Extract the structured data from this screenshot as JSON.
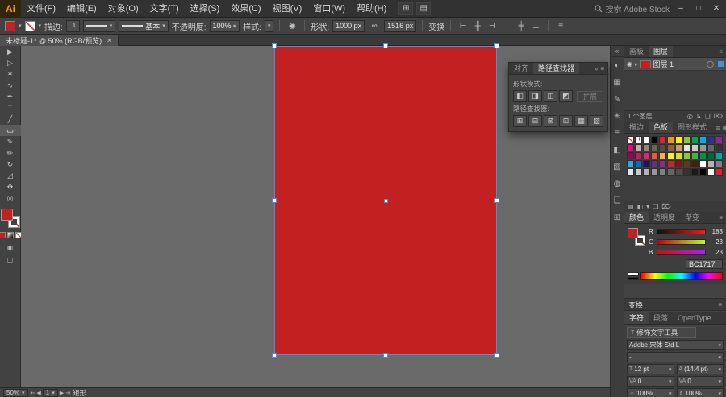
{
  "app": {
    "canvas_bg": "#6a6a6a"
  },
  "menubar": {
    "logo": "Ai",
    "items": [
      "文件(F)",
      "编辑(E)",
      "对象(O)",
      "文字(T)",
      "选择(S)",
      "效果(C)",
      "视图(V)",
      "窗口(W)",
      "帮助(H)"
    ],
    "app_icons": [
      {
        "name": "arrange-documents-icon",
        "glyph": "⊞"
      },
      {
        "name": "document-layout-icon",
        "glyph": "▤"
      }
    ],
    "search_label": "搜索 Adobe Stock",
    "window": {
      "minimize": "–",
      "restore": "□",
      "close": "✕"
    }
  },
  "controlbar": {
    "fill_color": "#C32021",
    "stroke_label": "描边:",
    "stroke_weight": "",
    "brush_value": "基本",
    "opacity_label": "不透明度:",
    "opacity_value": "100%",
    "style_label": "样式:",
    "recolor_glyph": "◉",
    "shape_label": "形状:",
    "width_value": "1000 px",
    "link_glyph": "∞",
    "height_value": "1516 px",
    "transform_label": "变换",
    "align_icons": [
      {
        "name": "align-left-icon",
        "glyph": "⊢"
      },
      {
        "name": "align-center-horizontal-icon",
        "glyph": "╫"
      },
      {
        "name": "align-right-icon",
        "glyph": "⊣"
      },
      {
        "name": "align-top-icon",
        "glyph": "⊤"
      },
      {
        "name": "align-middle-vertical-icon",
        "glyph": "╪"
      },
      {
        "name": "align-bottom-icon",
        "glyph": "⊥"
      }
    ],
    "menu_glyph": "≡"
  },
  "document_tab": {
    "title": "未标题-1* @ 50% (RGB/预览)",
    "close": "✕"
  },
  "tools": [
    {
      "name": "selection-tool",
      "glyph": "▶"
    },
    {
      "name": "direct-selection-tool",
      "glyph": "▷"
    },
    {
      "name": "magic-wand-tool",
      "glyph": "✶"
    },
    {
      "name": "lasso-tool",
      "glyph": "∿"
    },
    {
      "name": "pen-tool",
      "glyph": "✒"
    },
    {
      "name": "type-tool",
      "glyph": "T"
    },
    {
      "name": "line-segment-tool",
      "glyph": "╱"
    },
    {
      "name": "rectangle-tool",
      "glyph": "▭"
    },
    {
      "name": "paintbrush-tool",
      "glyph": "✎"
    },
    {
      "name": "pencil-tool",
      "glyph": "✏"
    },
    {
      "name": "rotate-tool",
      "glyph": "↻"
    },
    {
      "name": "scale-tool",
      "glyph": "◿"
    },
    {
      "name": "hand-tool",
      "glyph": "✥"
    },
    {
      "name": "zoom-tool",
      "glyph": "◎"
    }
  ],
  "artboard": {
    "fill": "#C32021"
  },
  "pathfinder_panel": {
    "tabs": [
      "对齐",
      "路径查找器"
    ],
    "collapse_glyph": "»",
    "menu_glyph": "≡",
    "shape_modes_label": "形状模式:",
    "expand_button": "扩展",
    "shape_mode_icons": [
      {
        "name": "unite-icon",
        "glyph": "◧"
      },
      {
        "name": "minus-front-icon",
        "glyph": "◨"
      },
      {
        "name": "intersect-icon",
        "glyph": "◫"
      },
      {
        "name": "exclude-icon",
        "glyph": "◩"
      }
    ],
    "pathfinder_label": "路径查找器:",
    "pathfinder_icons": [
      {
        "name": "divide-icon",
        "glyph": "⊞"
      },
      {
        "name": "trim-icon",
        "glyph": "⊟"
      },
      {
        "name": "merge-icon",
        "glyph": "⊠"
      },
      {
        "name": "crop-icon",
        "glyph": "⊡"
      },
      {
        "name": "outline-icon",
        "glyph": "▦"
      },
      {
        "name": "minus-back-icon",
        "glyph": "▧"
      }
    ]
  },
  "dock": {
    "expand_glyph": "«",
    "icons": [
      {
        "name": "color-panel-icon",
        "glyph": "◐"
      },
      {
        "name": "swatches-panel-icon",
        "glyph": "▦"
      },
      {
        "name": "brushes-panel-icon",
        "glyph": "✎"
      },
      {
        "name": "symbols-panel-icon",
        "glyph": "✳"
      },
      {
        "name": "stroke-panel-icon",
        "glyph": "≡"
      },
      {
        "name": "gradient-panel-icon",
        "glyph": "◧"
      },
      {
        "name": "transparency-panel-icon",
        "glyph": "▨"
      },
      {
        "name": "appearance-panel-icon",
        "glyph": "◍"
      },
      {
        "name": "graphic-styles-panel-icon",
        "glyph": "❏"
      },
      {
        "name": "align-panel-icon",
        "glyph": "⊞"
      }
    ]
  },
  "layers_panel": {
    "tabs": [
      "画板",
      "图层"
    ],
    "menu_glyph": "≡",
    "eye_glyph": "◉",
    "expand_glyph": "▸",
    "layer_name": "图层 1",
    "target_glyph": "◯",
    "footer_text": "1 个图层",
    "footer_icons": [
      {
        "name": "make-clipping-mask-icon",
        "glyph": "◎"
      },
      {
        "name": "new-sublayer-icon",
        "glyph": "↳"
      },
      {
        "name": "new-layer-icon",
        "glyph": "❏"
      },
      {
        "name": "delete-layer-icon",
        "glyph": "⌦"
      }
    ]
  },
  "swatches_panel": {
    "tabs": [
      "描边",
      "色板",
      "图形样式"
    ],
    "view_icons": [
      {
        "name": "list-view-icon",
        "glyph": "≣"
      },
      {
        "name": "grid-view-icon",
        "glyph": "▦"
      }
    ],
    "swatches": [
      "none",
      "registration",
      "#FFFFFF",
      "#000000",
      "#ED1C24",
      "#F7941D",
      "#FFF200",
      "#8DC63F",
      "#00A651",
      "#00AEEF",
      "#2E3192",
      "#92278F",
      "#EC008C",
      "#C7B299",
      "#998675",
      "#736357",
      "#594A42",
      "#8C6239",
      "#C69C6D",
      "#E6E6E6",
      "#CCCCCC",
      "#999999",
      "#666666",
      "#333333",
      "#9E005D",
      "#D4145A",
      "#ED1E79",
      "#F15A24",
      "#FBB03B",
      "#FCEE21",
      "#D9E021",
      "#8CC63F",
      "#39B54A",
      "#009245",
      "#006837",
      "#00A99D",
      "#29ABE2",
      "#0071BC",
      "#1B1464",
      "#662D91",
      "#93278F",
      "#C1272D",
      "#7F1416",
      "#603813",
      "#42210B",
      "#FFFFFF",
      "#B3B3B3",
      "#808080",
      "#E6E6E6",
      "#CCCCCC",
      "#B3B3B3",
      "#999999",
      "#808080",
      "#666666",
      "#4D4D4D",
      "#333333",
      "#1A1A1A",
      "#000000",
      "#FFFFFF",
      "#ED1C24"
    ],
    "footer_icons": [
      {
        "name": "swatch-libraries-icon",
        "glyph": "▤"
      },
      {
        "name": "swatch-kinds-icon",
        "glyph": "◧"
      },
      {
        "name": "swatch-options-icon",
        "glyph": "▾"
      },
      {
        "name": "new-color-group-icon",
        "glyph": "❏"
      },
      {
        "name": "delete-swatch-icon",
        "glyph": "⌦"
      }
    ]
  },
  "color_panel": {
    "tabs": [
      "颜色",
      "透明度",
      "渐变"
    ],
    "menu_glyph": "≡",
    "sliders": [
      {
        "label": "R",
        "value": "188"
      },
      {
        "label": "G",
        "value": "23"
      },
      {
        "label": "B",
        "value": "23"
      }
    ],
    "hex": "BC1717"
  },
  "transform_panel": {
    "title": "变换",
    "menu_glyph": "≡"
  },
  "character_panel": {
    "tabs": [
      "字符",
      "段落",
      "OpenType"
    ],
    "touch_type_icon": "T",
    "touch_type_label": "修饰文字工具",
    "font_name": "Adobe 宋体 Std L",
    "font_style": "-",
    "font_size": "12 pt",
    "leading": "(14.4 pt)",
    "kerning": "0",
    "tracking": "0",
    "h_scale": "100%",
    "v_scale": "100%"
  },
  "statusbar": {
    "zoom": "50%",
    "nav_first": "⇤",
    "nav_prev": "◀",
    "artboard_number": "1",
    "nav_next": "▶",
    "nav_last": "⇥",
    "tool_name": "矩形"
  }
}
